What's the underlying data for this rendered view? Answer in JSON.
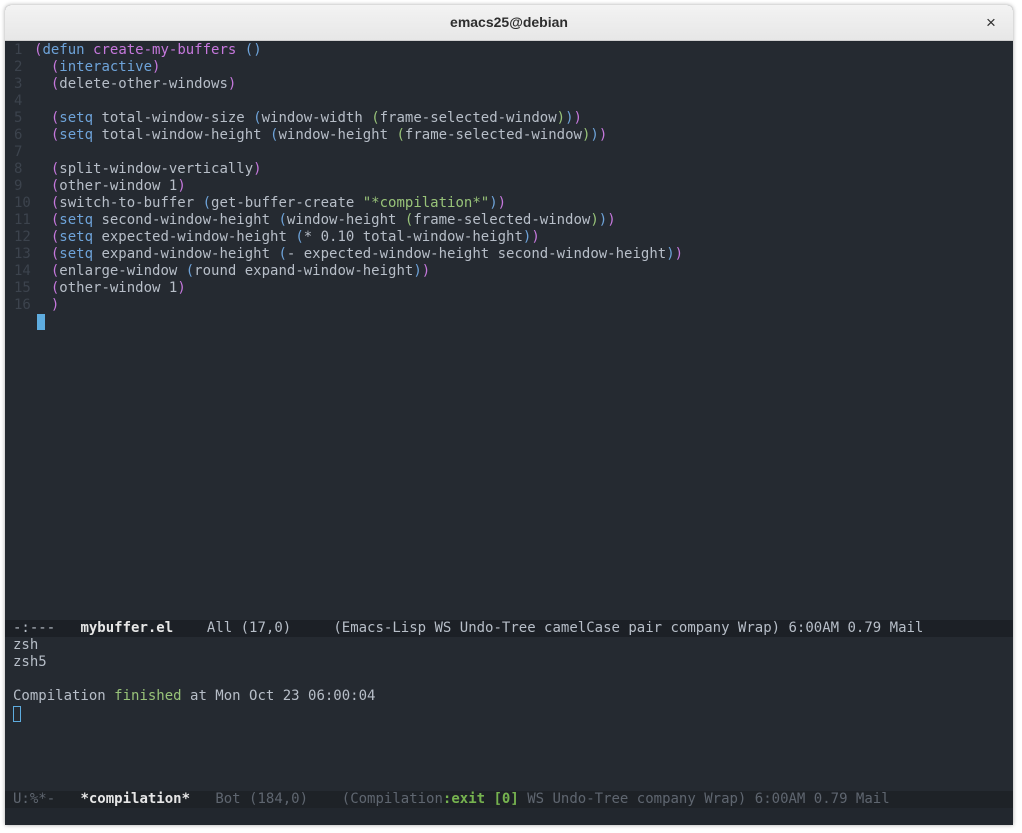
{
  "window": {
    "title": "emacs25@debian",
    "close_glyph": "×"
  },
  "editor": {
    "line_numbers": [
      "1",
      "2",
      "3",
      "4",
      "5",
      "6",
      "7",
      "8",
      "9",
      "10",
      "11",
      "12",
      "13",
      "14",
      "15",
      "16"
    ],
    "lines": [
      "(defun create-my-buffers ()",
      "  (interactive)",
      "  (delete-other-windows)",
      "",
      "  (setq total-window-size (window-width (frame-selected-window)))",
      "  (setq total-window-height (window-height (frame-selected-window)))",
      "",
      "  (split-window-vertically)",
      "  (other-window 1)",
      "  (switch-to-buffer (get-buffer-create \"*compilation*\"))",
      "  (setq second-window-height (window-height (frame-selected-window)))",
      "  (setq expected-window-height (* 0.10 total-window-height))",
      "  (setq expand-window-height (- expected-window-height second-window-height))",
      "  (enlarge-window (round expand-window-height))",
      "  (other-window 1)",
      "  )"
    ]
  },
  "modeline_top": {
    "status": "-:---",
    "buffer": "mybuffer.el",
    "position": "All (17,0)",
    "modes": "(Emacs-Lisp WS Undo-Tree camelCase pair company Wrap) 6:00AM 0.79 Mail"
  },
  "compilation": {
    "line1": "zsh",
    "line2": "zsh5",
    "line3_prefix": "Compilation ",
    "line3_status": "finished",
    "line3_suffix": " at Mon Oct 23 06:00:04"
  },
  "modeline_bottom": {
    "status": "U:%*-",
    "buffer": "*compilation*",
    "position": "Bot (184,0)",
    "modes_prefix": "(Compilation",
    "exit_status": ":exit [0]",
    "modes_suffix": " WS Undo-Tree company Wrap) 6:00AM 0.79 Mail"
  },
  "colors": {
    "editor_bg": "#252a31",
    "modeline_bg": "#1c2026",
    "keyword": "#6ea3d9",
    "function": "#c678dd",
    "string": "#98c379",
    "cursor": "#5eacdf"
  }
}
